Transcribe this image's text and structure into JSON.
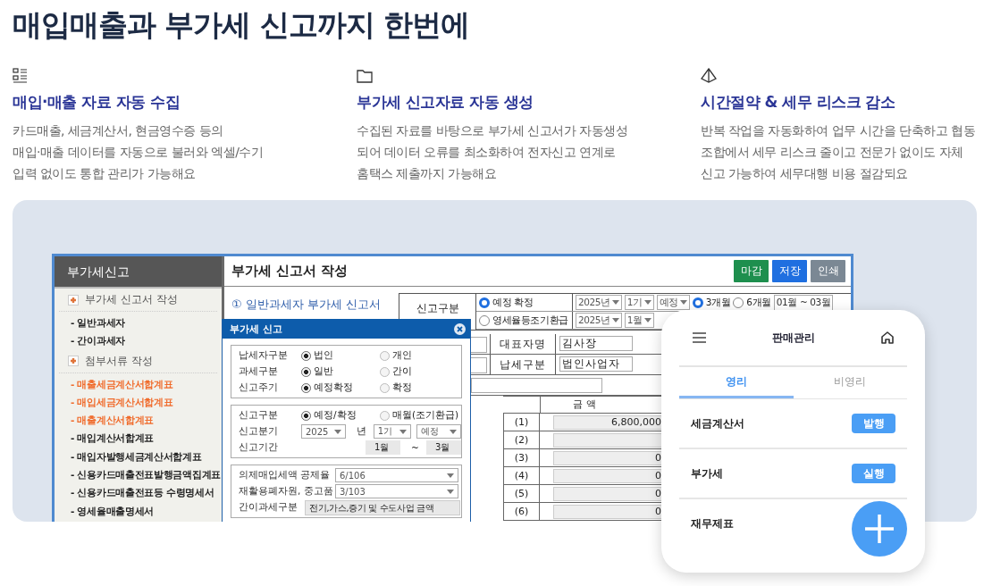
{
  "headline": "매입매출과 부가세 신고까지 한번에",
  "features": [
    {
      "title": "매입·매출 자료 자동 수집",
      "description": [
        "카드매출, 세금계산서, 현금영수증 등의",
        "매입·매출 데이터를 자동으로 불러와 엑셀/수기",
        "입력 없이도 통합 관리가 가능해요"
      ]
    },
    {
      "title": "부가세 신고자료 자동 생성",
      "description": [
        "수집된 자료를 바탕으로 부가세 신고서가 자동생성",
        "되어 데이터 오류를 최소화하여 전자신고 연계로",
        "홈택스 제출까지 가능해요"
      ]
    },
    {
      "title": "시간절약 & 세무 리스크 감소",
      "description": [
        "반복 작업을 자동화하여 업무 시간을 단축하고 협동",
        "조합에서 세무 리스크 줄이고 전문가 없이도 자체",
        "신고 가능하여 세무대행 비용 절감되요"
      ]
    }
  ],
  "app": {
    "sidebar": {
      "title": "부가세신고",
      "items": [
        {
          "kind": "section",
          "label": "부가세 신고서 작성"
        },
        {
          "kind": "link",
          "label": "- 일반과세자",
          "highlighted": false
        },
        {
          "kind": "link",
          "label": "- 간이과세자",
          "highlighted": false
        },
        {
          "kind": "section",
          "label": "첨부서류 작성"
        },
        {
          "kind": "link",
          "label": "- 매출세금계산서합계표",
          "highlighted": true
        },
        {
          "kind": "link",
          "label": "- 매입세금계산서합계표",
          "highlighted": true
        },
        {
          "kind": "link",
          "label": "- 매출계산서합계표",
          "highlighted": true
        },
        {
          "kind": "link",
          "label": "- 매입계산서합계표",
          "highlighted": false
        },
        {
          "kind": "link",
          "label": "- 매입자발행세금계산서합계표",
          "highlighted": false
        },
        {
          "kind": "link",
          "label": "- 신용카드매출전표발행금액집계표",
          "highlighted": false
        },
        {
          "kind": "link",
          "label": "- 신용카드매출전표등 수령명세서",
          "highlighted": false
        },
        {
          "kind": "link",
          "label": "- 영세율매출명세서",
          "highlighted": false
        }
      ]
    },
    "title": "부가세 신고서 작성",
    "buttons": [
      {
        "label": "마감",
        "color": "#1e8f4e"
      },
      {
        "label": "저장",
        "color": "#1f6fe0"
      },
      {
        "label": "인쇄",
        "color": "#7b8894"
      }
    ],
    "form_title": "① 일반과세자 부가세 신고서",
    "filing": {
      "label": "신고구분",
      "rows": [
        {
          "option": {
            "label": "예정 확정",
            "selected": true
          },
          "selects": [
            "2025년",
            "1기",
            "예정"
          ],
          "periods": [
            {
              "label": "3개월",
              "selected": true
            },
            {
              "label": "6개월",
              "selected": false
            }
          ],
          "range": "01월 ~ 03월"
        },
        {
          "option": {
            "label": "영세율등조기환급",
            "selected": false
          },
          "selects": [
            "2025년",
            "1월"
          ]
        }
      ]
    },
    "info": [
      {
        "label": "대표자명",
        "value": "김사장"
      },
      {
        "label": "납세구분",
        "value": "법인사업자"
      }
    ],
    "amounts": {
      "header": "금 액",
      "rows": [
        {
          "no": "(1)",
          "amount": "6,800,000"
        },
        {
          "no": "(2)"
        },
        {
          "no": "(3)",
          "amount": "0"
        },
        {
          "no": "(4)",
          "amount": "0"
        },
        {
          "no": "(5)",
          "amount": "0"
        },
        {
          "no": "(6)",
          "amount": "0"
        }
      ]
    },
    "dialog": {
      "title": "부가세 신고",
      "groups": [
        [
          {
            "kind": "radio",
            "label": "납세자구분",
            "options": [
              {
                "label": "법인",
                "selected": true
              },
              {
                "label": "개인",
                "selected": false
              }
            ]
          },
          {
            "kind": "radio",
            "label": "과세구분",
            "options": [
              {
                "label": "일반",
                "selected": true
              },
              {
                "label": "간이",
                "selected": false
              }
            ]
          },
          {
            "kind": "radio",
            "label": "신고주기",
            "options": [
              {
                "label": "예정확정",
                "selected": true
              },
              {
                "label": "확정",
                "selected": false
              }
            ]
          }
        ],
        [
          {
            "kind": "radio",
            "label": "신고구분",
            "options": [
              {
                "label": "예정/확정",
                "selected": true
              },
              {
                "label": "매월(조기환급)",
                "selected": false
              }
            ]
          },
          {
            "kind": "quarter",
            "label": "신고분기",
            "year": "2025",
            "unit": "년",
            "half": "1기",
            "type": "예정"
          },
          {
            "kind": "range",
            "label": "신고기간",
            "from": "1월",
            "separator": "~",
            "to": "3월"
          }
        ],
        [
          {
            "kind": "select",
            "label": "의제매입세액 공제율",
            "value": "6/106"
          },
          {
            "kind": "select",
            "label": "재활용폐자원, 중고품",
            "value": "3/103"
          },
          {
            "kind": "text",
            "label": "간이과세구분",
            "value": "전기,가스,증기 및 수도사업 금액"
          }
        ]
      ]
    }
  },
  "mobile": {
    "title": "판매관리",
    "tabs": [
      {
        "label": "영리",
        "selected": true
      },
      {
        "label": "비영리",
        "selected": false
      }
    ],
    "rows": [
      {
        "label": "세금계산서",
        "action": "발행"
      },
      {
        "label": "부가세",
        "action": "실행"
      },
      {
        "label": "재무제표"
      }
    ]
  }
}
